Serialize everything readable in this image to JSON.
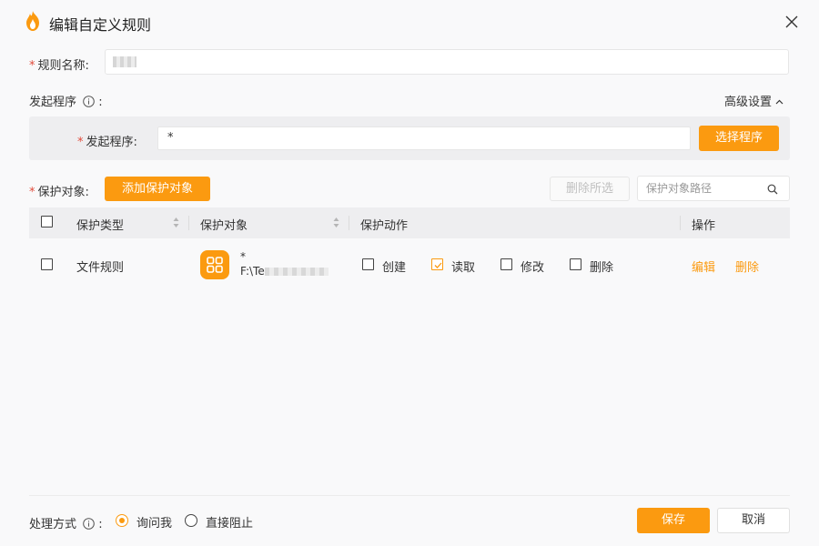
{
  "window": {
    "title": "编辑自定义规则",
    "logo_icon": "flame-shield-icon",
    "close_icon": "close-icon"
  },
  "rule_name": {
    "required_mark": "*",
    "label": "规则名称:",
    "value": ""
  },
  "launcher": {
    "section_label": "发起程序",
    "section_suffix": ":",
    "advanced_settings": "高级设置",
    "required_mark": "*",
    "label": "发起程序:",
    "value": "*",
    "select_button": "选择程序"
  },
  "protect": {
    "required_mark": "*",
    "label": "保护对象:",
    "add_button": "添加保护对象",
    "delete_selected_button": "删除所选",
    "search_placeholder": "保护对象路径"
  },
  "table": {
    "columns": [
      "保护类型",
      "保护对象",
      "保护动作",
      "操作"
    ],
    "rows": [
      {
        "type": "文件规则",
        "object_name": "*",
        "object_path": "F:\\Te",
        "actions": [
          {
            "label": "创建",
            "checked": false
          },
          {
            "label": "读取",
            "checked": true
          },
          {
            "label": "修改",
            "checked": false
          },
          {
            "label": "删除",
            "checked": false
          }
        ],
        "edit": "编辑",
        "delete": "删除"
      }
    ]
  },
  "footer": {
    "handling_label": "处理方式",
    "handling_suffix": ":",
    "options": [
      {
        "label": "询问我",
        "selected": true
      },
      {
        "label": "直接阻止",
        "selected": false
      }
    ],
    "save_button": "保存",
    "cancel_button": "取消"
  },
  "colors": {
    "accent": "#fb9a10",
    "required": "#e14b3b",
    "panel": "#eeeef0"
  }
}
